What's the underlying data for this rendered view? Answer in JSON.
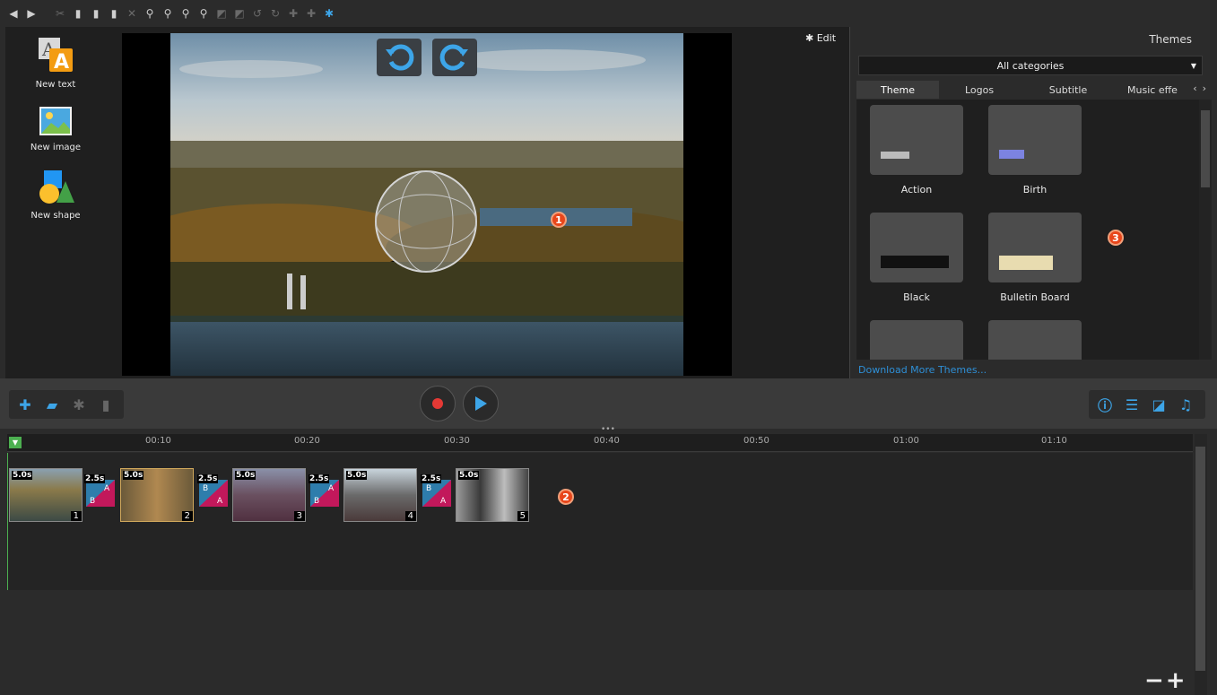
{
  "toolbar": {
    "icons": [
      "back-icon",
      "forward-icon",
      "cut-icon",
      "copy-icon",
      "paste-icon",
      "duplicate-icon",
      "delete-icon",
      "zoom-in-icon",
      "zoom-in-alt-icon",
      "zoom-out-icon",
      "zoom-fit-icon",
      "crop-icon",
      "split-icon",
      "rotate-left-icon",
      "rotate-right-icon",
      "move-left-icon",
      "move-right-icon",
      "settings-icon"
    ]
  },
  "left_panel": {
    "new_text": "New text",
    "new_image": "New image",
    "new_shape": "New shape"
  },
  "preview": {
    "edit_label": "Edit",
    "badge1": "1"
  },
  "themes_panel": {
    "title": "Themes",
    "category": "All categories",
    "tabs": [
      "Theme",
      "Logos",
      "Subtitle",
      "Music effe"
    ],
    "themes": [
      {
        "name": "Action"
      },
      {
        "name": "Birth"
      },
      {
        "name": "Black"
      },
      {
        "name": "Bulletin Board"
      },
      {
        "name": ""
      },
      {
        "name": ""
      }
    ],
    "download_more": "Download More Themes...",
    "badge3": "3"
  },
  "timeline": {
    "ticks": [
      "00:10",
      "00:20",
      "00:30",
      "00:40",
      "00:50",
      "01:00",
      "01:10"
    ],
    "clips": [
      {
        "duration": "5.0s",
        "number": "1"
      },
      {
        "duration": "5.0s",
        "number": "2"
      },
      {
        "duration": "5.0s",
        "number": "3"
      },
      {
        "duration": "5.0s",
        "number": "4"
      },
      {
        "duration": "5.0s",
        "number": "5"
      }
    ],
    "transitions": [
      {
        "duration": "2.5s"
      },
      {
        "duration": "2.5s"
      },
      {
        "duration": "2.5s"
      },
      {
        "duration": "2.5s"
      }
    ],
    "badge2": "2"
  },
  "colors": {
    "accent": "#3da5e8",
    "record": "#e53935",
    "badge": "#e8461b",
    "link": "#2e8fd6"
  }
}
